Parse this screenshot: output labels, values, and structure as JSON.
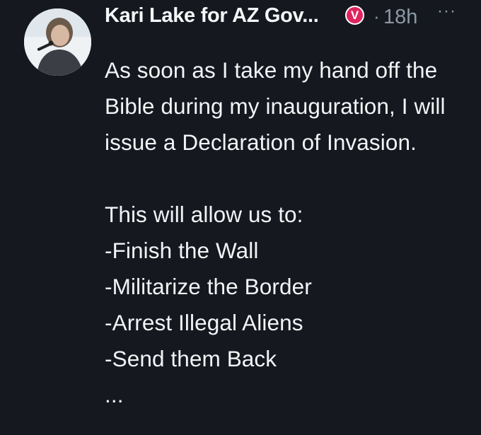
{
  "tweet": {
    "author_name": "Kari Lake for AZ Gov...",
    "verified_icon": "v-badge-icon",
    "verified_label": "V",
    "time_separator": "·",
    "timestamp": "18h",
    "more_label": "···",
    "body": "As soon as I take my hand off the Bible during my inauguration, I will issue a Declaration of Invasion.\n\nThis will allow us to:\n-Finish the Wall\n-Militarize the Border\n-Arrest Illegal Aliens\n-Send them Back\n..."
  },
  "colors": {
    "background": "#15191f",
    "text": "#f2f4f6",
    "muted": "#8b98a5",
    "badge": "#e0245e"
  }
}
